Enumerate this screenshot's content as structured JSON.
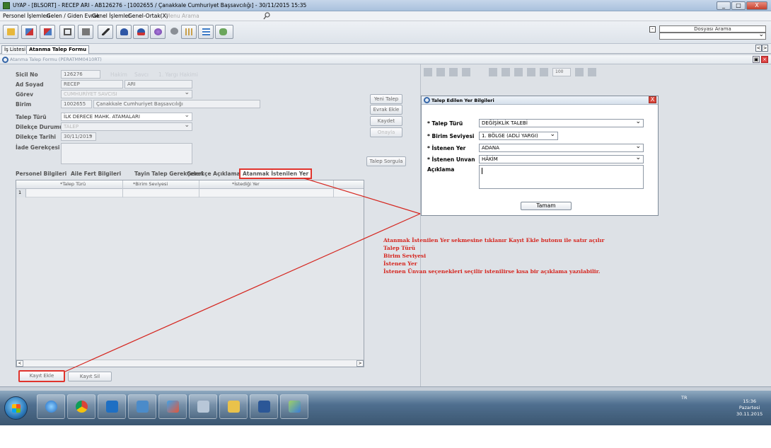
{
  "window": {
    "title": "UYAP - [BLSORT] - RECEP ARI - AB126276 - [1002655 / Çanakkale Cumhuriyet Başsavcılığı] - 30/11/2015 15:35",
    "controls": [
      "_",
      "□",
      "X"
    ]
  },
  "menu": {
    "items": [
      "Personel İşlemleri",
      "Gelen / Giden Evrak",
      "Genel İşlemler",
      "Genel-Ortak(X)"
    ],
    "search_placeholder": "Menu Arama"
  },
  "toolbar": {
    "icons": [
      "folder-icon",
      "send-icon",
      "reject-icon",
      "copy-icon",
      "delete-icon",
      "pen-icon",
      "user-add-icon",
      "user-remove-icon",
      "globe-icon",
      "circle-icon",
      "hash-icon",
      "grid-icon",
      "people-icon"
    ],
    "dossier_search_label": "Dosyası Arama",
    "dossier_checkbox": "-"
  },
  "tabs": {
    "items": [
      "İş Listesi",
      "Atanma Talep Formu"
    ],
    "active": "Atanma Talep Formu",
    "nav": [
      "<",
      ">"
    ]
  },
  "form_header": {
    "title": "Atanma Talep Formu (PERATMM0410RT)"
  },
  "personal": {
    "sicil_no_label": "Sicil No",
    "sicil_no": "126276",
    "hakim_label": "Hakim",
    "savci_label": "Savcı",
    "yargi_label": "1. Yargı Hakimi",
    "ad_soyad_label": "Ad Soyad",
    "ad": "RECEP",
    "soyad": "ARI",
    "gorev_label": "Görev",
    "gorev": "CUMHURİYET SAVCISI",
    "birim_label": "Birim",
    "birim_kodu": "1002655",
    "birim_adi": "Çanakkale Cumhuriyet Başsavcılığı",
    "talep_turu_label": "Talep Türü",
    "talep_turu": "İLK DERECE MAHK. ATAMALARI",
    "dilekce_durumu_label": "Dilekçe Durumu",
    "dilekce_durumu": "TALEP",
    "dilekce_tarihi_label": "Dilekçe Tarihi",
    "dilekce_tarihi": "30/11/2015",
    "iade_label": "İade Gerekçesi"
  },
  "actions": {
    "yeni_talep": "Yeni Talep",
    "evrak_ekle": "Evrak Ekle",
    "kaydet": "Kaydet",
    "onayla": "Onayla",
    "talep_sorgula": "Talep Sorgula"
  },
  "subtabs": {
    "items": [
      "Personel Bilgileri",
      "Aile Fert Bilgileri",
      "Tayin Talep Gerekçeleri",
      "Gerekçe Açıklaması",
      "Atanmak İstenilen Yer"
    ],
    "active": "Atanmak İstenilen Yer"
  },
  "grid": {
    "columns": [
      "*Talep Türü",
      "*Birim Seviyesi",
      "*İstediği Yer"
    ],
    "row_numbers": [
      "1"
    ],
    "scroll": [
      "<",
      ">"
    ]
  },
  "grid_buttons": {
    "kayit_ekle": "Kayıt Ekle",
    "kayit_sil": "Kayıt Sil"
  },
  "right_toolbar": {
    "page_field": "100"
  },
  "dialog": {
    "title": "Talep Edilen Yer Bilgileri",
    "close": "X",
    "talep_turu_label": "* Talep Türü",
    "talep_turu": "DEĞİŞİKLİK TALEBİ",
    "birim_seviyesi_label": "* Birim Seviyesi",
    "birim_seviyesi": "1. BÖLGE (ADLİ YARGI)",
    "istenen_yer_label": "* İstenen Yer",
    "istenen_yer": "ADANA",
    "istenen_unvan_label": "* İstenen Unvan",
    "istenen_unvan": "HÂKİM",
    "aciklama_label": "Açıklama",
    "ok": "Tamam"
  },
  "annotation": {
    "lines": [
      "Atanmak İstenilen Yer sekmesine tıklanır Kayıt Ekle butonu ile satır açılır",
      "Talep Türü",
      "Birim Seviyesi",
      "İstenen Yer",
      "İstenen Ünvan seçenekleri seçilir istenilirse kısa bir açıklama yazılabilir."
    ],
    "color": "#d5261f"
  },
  "taskbar": {
    "apps": [
      "internet-explorer-icon",
      "chrome-icon",
      "outlook-icon",
      "network-icon",
      "paint-icon",
      "calculator-icon",
      "explorer-icon",
      "word-icon",
      "paint-brush-icon"
    ],
    "lang": "TR",
    "time": "15:36",
    "day": "Pazartesi",
    "date": "30.11.2015"
  }
}
